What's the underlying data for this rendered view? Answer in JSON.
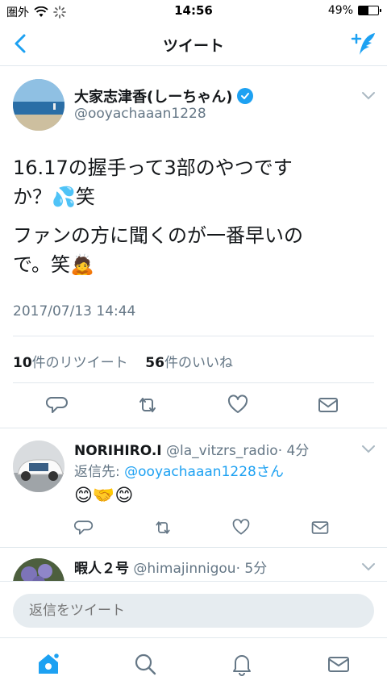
{
  "status_bar": {
    "carrier": "圏外",
    "time": "14:56",
    "battery": "49%",
    "battery_level": 0.49
  },
  "nav": {
    "title": "ツイート",
    "back_icon": "chevron-left-icon",
    "compose_icon": "compose-tweet-icon"
  },
  "tweet": {
    "author_name": "大家志津香(しーちゃん)",
    "author_handle": "@ooyachaaan1228",
    "text_lines": [
      "16.17の握手って3部のやつです",
      "か？💦笑"
    ],
    "text_lines2": [
      "ファンの方に聞くのが一番早いの",
      "で。笑🙇"
    ],
    "timestamp": "2017/07/13 14:44",
    "retweet_count": "10",
    "retweet_label": "件のリツイート",
    "like_count": "56",
    "like_label": "件のいいね"
  },
  "replies": [
    {
      "name": "NORIHIRO.I",
      "handle": "@la_vitzrs_radio",
      "age": "· 4分",
      "reply_to_prefix": "返信先: ",
      "reply_to_user": "@ooyachaaan1228さん",
      "text": "😊🤝😊"
    },
    {
      "name": "暇人２号",
      "handle": "@himajinnigou",
      "age": "· 5分"
    }
  ],
  "reply_bar": {
    "placeholder": "返信をツイート"
  },
  "tab_bar": {
    "items": [
      "home-icon",
      "search-icon",
      "notifications-icon",
      "messages-icon"
    ]
  },
  "colors": {
    "accent": "#1da1f2",
    "secondary_text": "#657786",
    "divider": "#e1e8ed"
  }
}
